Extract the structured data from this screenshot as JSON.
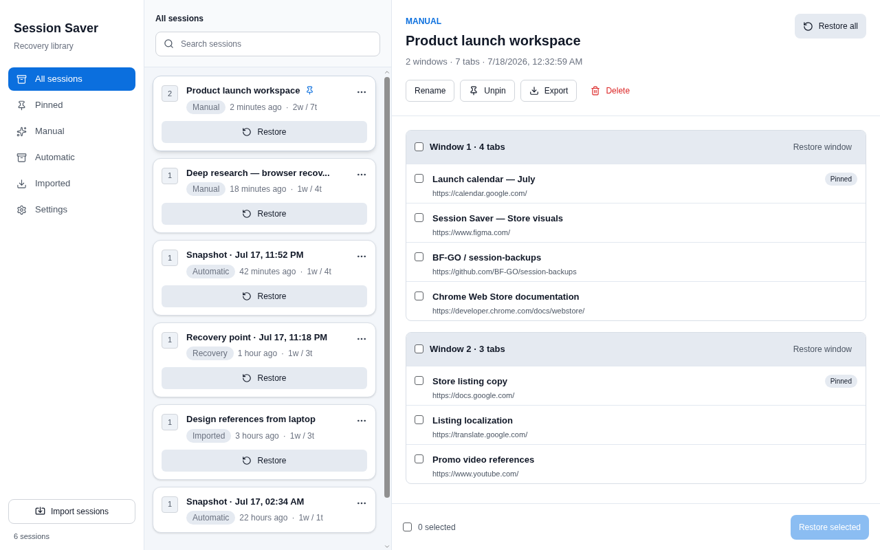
{
  "sidebar": {
    "title": "Session Saver",
    "subtitle": "Recovery library",
    "items": [
      {
        "label": "All sessions",
        "selected": true
      },
      {
        "label": "Pinned",
        "selected": false
      },
      {
        "label": "Manual",
        "selected": false
      },
      {
        "label": "Automatic",
        "selected": false
      },
      {
        "label": "Imported",
        "selected": false
      },
      {
        "label": "Settings",
        "selected": false
      }
    ],
    "import_button": "Import sessions",
    "count": "6 sessions"
  },
  "session_list": {
    "heading": "All sessions",
    "search": {
      "placeholder": "Search sessions"
    },
    "sessions": [
      {
        "windows": "2",
        "title": "Product launch workspace",
        "pinned": true,
        "source": "Manual",
        "time": "2 minutes ago",
        "separator": "·",
        "counts": "2w / 7t",
        "restore": "Restore",
        "selected": true
      },
      {
        "windows": "1",
        "title": "Deep research — browser recov...",
        "pinned": false,
        "source": "Manual",
        "time": "18 minutes ago",
        "separator": "·",
        "counts": "1w / 4t",
        "restore": "Restore",
        "selected": false
      },
      {
        "windows": "1",
        "title": "Snapshot · Jul 17, 11:52 PM",
        "pinned": false,
        "source": "Automatic",
        "time": "42 minutes ago",
        "separator": "·",
        "counts": "1w / 4t",
        "restore": "Restore",
        "selected": false
      },
      {
        "windows": "1",
        "title": "Recovery point · Jul 17, 11:18 PM",
        "pinned": false,
        "source": "Recovery",
        "time": "1 hour ago",
        "separator": "·",
        "counts": "1w / 3t",
        "restore": "Restore",
        "selected": false
      },
      {
        "windows": "1",
        "title": "Design references from laptop",
        "pinned": false,
        "source": "Imported",
        "time": "3 hours ago",
        "separator": "·",
        "counts": "1w / 3t",
        "restore": "Restore",
        "selected": false
      },
      {
        "windows": "1",
        "title": "Snapshot · Jul 17, 02:34 AM",
        "pinned": false,
        "source": "Automatic",
        "time": "22 hours ago",
        "separator": "·",
        "counts": "1w / 1t",
        "selected": false
      }
    ]
  },
  "detail": {
    "source": "MANUAL",
    "title": "Product launch workspace",
    "meta": "2 windows · 7 tabs · 7/18/2026, 12:32:59 AM",
    "restore_all": "Restore all",
    "actions": [
      {
        "label": "Rename",
        "kind": "plain"
      },
      {
        "label": "Unpin",
        "kind": "pin"
      },
      {
        "label": "Export",
        "kind": "export"
      },
      {
        "label": "Delete",
        "kind": "delete"
      }
    ],
    "windows": [
      {
        "title": "Window 1 · 4 tabs",
        "checked": false,
        "restore": "Restore window",
        "tabs": [
          {
            "title": "Launch calendar — July",
            "url": "https://calendar.google.com/",
            "checked": false,
            "badge": "Pinned"
          },
          {
            "title": "Session Saver — Store visuals",
            "url": "https://www.figma.com/",
            "checked": false
          },
          {
            "title": "BF-GO / session-backups",
            "url": "https://github.com/BF-GO/session-backups",
            "checked": false
          },
          {
            "title": "Chrome Web Store documentation",
            "url": "https://developer.chrome.com/docs/webstore/",
            "checked": false
          }
        ]
      },
      {
        "title": "Window 2 · 3 tabs",
        "checked": false,
        "restore": "Restore window",
        "tabs": [
          {
            "title": "Store listing copy",
            "url": "https://docs.google.com/",
            "checked": false,
            "badge": "Pinned"
          },
          {
            "title": "Listing localization",
            "url": "https://translate.google.com/",
            "checked": false
          },
          {
            "title": "Promo video references",
            "url": "https://www.youtube.com/",
            "checked": false
          }
        ]
      }
    ],
    "footer": {
      "checked": false,
      "selected_count": "0 selected",
      "restore_selected": "Restore selected",
      "disabled": true
    }
  }
}
